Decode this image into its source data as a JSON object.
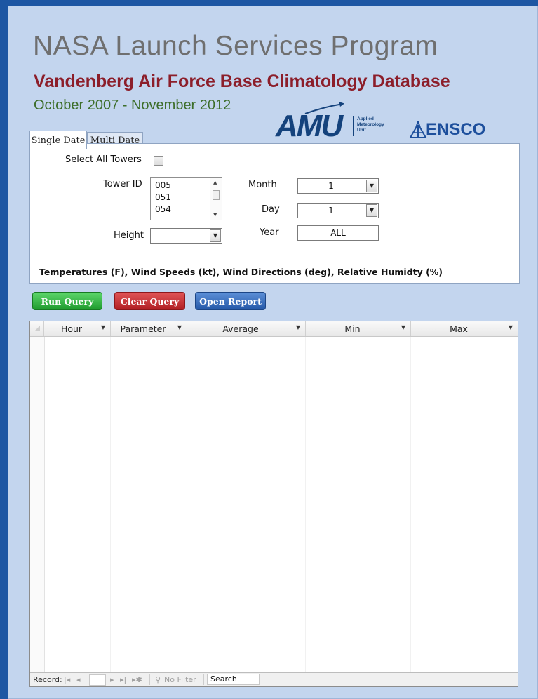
{
  "header": {
    "title": "NASA Launch Services Program",
    "subtitle": "Vandenberg Air Force Base Climatology Database",
    "date_range": "October 2007 - November 2012"
  },
  "logos": {
    "amu": {
      "word": "AMU",
      "line1": "Applied",
      "line2": "Meteorology",
      "line3": "Unit",
      "icon": "amu-logo"
    },
    "ensco": {
      "word": "ENSCO",
      "icon": "ensco-logo"
    }
  },
  "tabs": [
    {
      "label": "Single Date",
      "active": true
    },
    {
      "label": "Multi Date",
      "active": false
    }
  ],
  "form": {
    "select_all_towers_label": "Select All Towers",
    "select_all_towers_checked": false,
    "tower_id_label": "Tower ID",
    "tower_ids": [
      "005",
      "051",
      "054"
    ],
    "height_label": "Height",
    "height_value": "",
    "month_label": "Month",
    "month_value": "1",
    "day_label": "Day",
    "day_value": "1",
    "year_label": "Year",
    "year_value": "ALL",
    "units_note": "Temperatures (F), Wind Speeds (kt), Wind Directions (deg), Relative Humidty (%)"
  },
  "actions": {
    "run_query": "Run Query",
    "clear_query": "Clear Query",
    "open_report": "Open Report"
  },
  "datasheet": {
    "columns": [
      "Hour",
      "Parameter",
      "Average",
      "Min",
      "Max"
    ],
    "rows": []
  },
  "navbar": {
    "record_label": "Record:",
    "first": "|◂",
    "prev": "◂",
    "next": "▸",
    "last": "▸|",
    "new": "▸✱",
    "filter_label": "No Filter",
    "search_label": "Search"
  },
  "colors": {
    "background": "#1d56a3",
    "panel": "#c3d5ee",
    "title": "#6f6f6f",
    "subtitle": "#8c1e2a",
    "date_range": "#3d6e2a",
    "run_query": "#1f9b2e",
    "clear_query": "#b11f24",
    "open_report": "#2458a8"
  }
}
